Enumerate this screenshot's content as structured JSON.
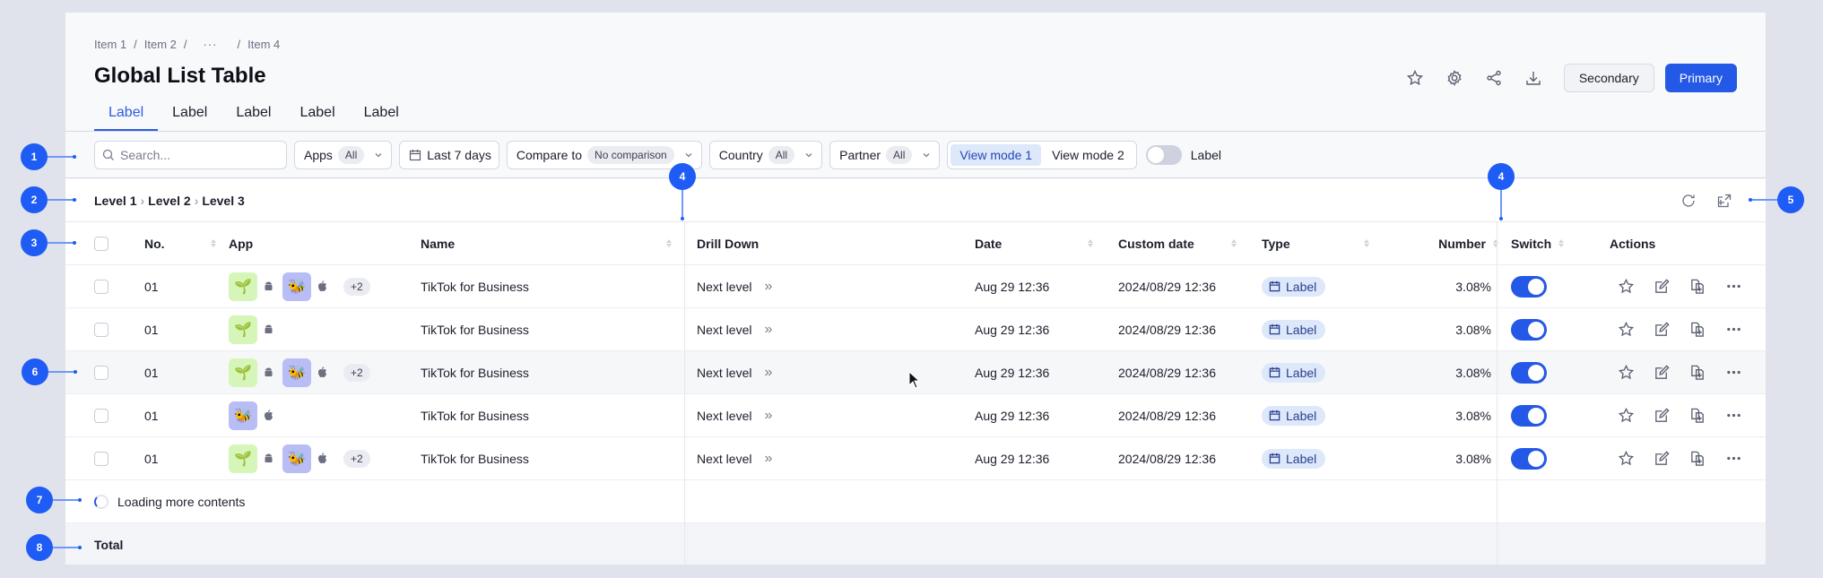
{
  "breadcrumb": [
    "Item 1",
    "Item 2",
    "···",
    "Item 4"
  ],
  "page_title": "Global List Table",
  "tabs": [
    {
      "label": "Label",
      "active": true
    },
    {
      "label": "Label",
      "active": false
    },
    {
      "label": "Label",
      "active": false
    },
    {
      "label": "Label",
      "active": false
    },
    {
      "label": "Label",
      "active": false
    }
  ],
  "header_actions": {
    "icons": [
      "star-icon",
      "gear-icon",
      "share-icon",
      "download-icon"
    ],
    "secondary_label": "Secondary",
    "primary_label": "Primary"
  },
  "filters": {
    "search_placeholder": "Search...",
    "apps": {
      "label": "Apps",
      "value": "All"
    },
    "date_range": "Last 7 days",
    "compare": {
      "label": "Compare to",
      "value": "No comparison"
    },
    "country": {
      "label": "Country",
      "value": "All"
    },
    "partner": {
      "label": "Partner",
      "value": "All"
    },
    "view_modes": [
      "View mode 1",
      "View mode 2"
    ],
    "active_view_mode": "View mode 1",
    "toggle_label": "Label",
    "toggle_on": false
  },
  "level_breadcrumb": [
    "Level 1",
    "Level 2",
    "Level 3"
  ],
  "level_actions": [
    "refresh-icon",
    "export-icon"
  ],
  "table": {
    "columns": [
      "No.",
      "App",
      "Name",
      "Drill Down",
      "Date",
      "Custom date",
      "Type",
      "Number",
      "Switch",
      "Actions"
    ],
    "rows": [
      {
        "no": "01",
        "apps": [
          "sprout",
          "bee"
        ],
        "extra": "+2",
        "name": "TikTok for Business",
        "drill": "Next level",
        "date": "Aug 29 12:36",
        "custom_date": "2024/08/29 12:36",
        "type": "Label",
        "number": "3.08%",
        "switch": true
      },
      {
        "no": "01",
        "apps": [
          "sprout"
        ],
        "extra": "",
        "name": "TikTok for Business",
        "drill": "Next level",
        "date": "Aug 29 12:36",
        "custom_date": "2024/08/29 12:36",
        "type": "Label",
        "number": "3.08%",
        "switch": true
      },
      {
        "no": "01",
        "apps": [
          "sprout",
          "bee"
        ],
        "extra": "+2",
        "name": "TikTok for Business",
        "drill": "Next level",
        "date": "Aug 29 12:36",
        "custom_date": "2024/08/29 12:36",
        "type": "Label",
        "number": "3.08%",
        "switch": true
      },
      {
        "no": "01",
        "apps": [
          "bee"
        ],
        "extra": "",
        "name": "TikTok for Business",
        "drill": "Next level",
        "date": "Aug 29 12:36",
        "custom_date": "2024/08/29 12:36",
        "type": "Label",
        "number": "3.08%",
        "switch": true
      },
      {
        "no": "01",
        "apps": [
          "sprout",
          "bee"
        ],
        "extra": "+2",
        "name": "TikTok for Business",
        "drill": "Next level",
        "date": "Aug 29 12:36",
        "custom_date": "2024/08/29 12:36",
        "type": "Label",
        "number": "3.08%",
        "switch": true
      }
    ],
    "loading_text": "Loading more contents",
    "total_label": "Total"
  },
  "annotations": [
    "1",
    "2",
    "3",
    "4",
    "4",
    "5",
    "6",
    "7",
    "8"
  ],
  "colors": {
    "primary": "#2458e6",
    "annotation": "#1e5cf5",
    "tag_bg": "#dde8fa"
  }
}
